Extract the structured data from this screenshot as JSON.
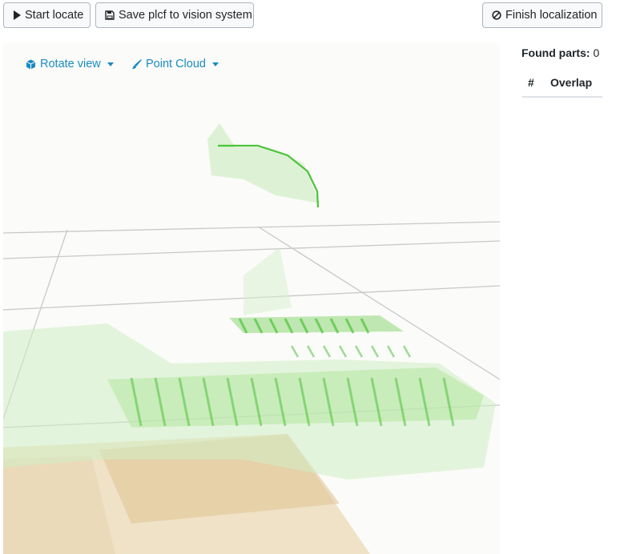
{
  "toolbar": {
    "start_label": "Start locate",
    "save_label": "Save plcf to vision system",
    "finish_label": "Finish localization"
  },
  "view_controls": {
    "rotate_label": "Rotate view",
    "point_cloud_label": "Point Cloud"
  },
  "results": {
    "found_label": "Found parts:",
    "found_count": "0",
    "columns": [
      "#",
      "Overlap"
    ]
  },
  "icons": {
    "start": "play-icon",
    "save": "floppy-disk-icon",
    "finish": "ban-icon",
    "rotate": "cube-icon",
    "cloud": "paintbrush-icon"
  },
  "colors": {
    "accent": "#1a8bc2",
    "cloud_green": "#4cc33a",
    "cloud_tan": "#d9b77f",
    "grid": "#c8c8c8"
  }
}
